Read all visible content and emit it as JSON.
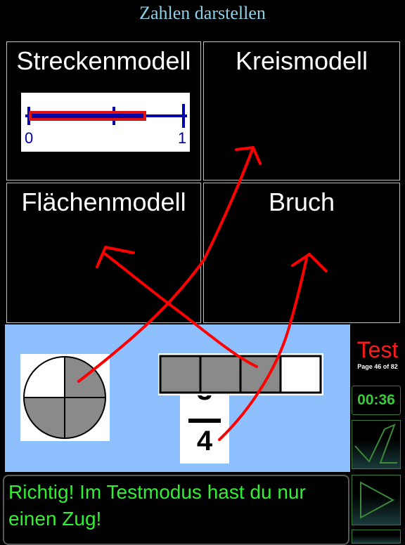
{
  "header": {
    "title": "Zahlen darstellen"
  },
  "targets": {
    "strecke": "Streckenmodell",
    "kreis": "Kreismodell",
    "flaeche": "Flächenmodell",
    "bruch": "Bruch"
  },
  "number_line": {
    "start_label": "0",
    "end_label": "1",
    "marked_fraction": 0.75
  },
  "pieces": {
    "circle": {
      "parts": 4,
      "shaded": 3
    },
    "bar": {
      "parts": 4,
      "shaded": 3
    },
    "fraction": {
      "numerator": "3",
      "denominator": "4"
    }
  },
  "status": {
    "mode_label": "Test",
    "page_info": "Page 46 of 82",
    "timer": "00:36"
  },
  "feedback": {
    "message": "Richtig! Im Testmodus hast du nur einen Zug!"
  },
  "colors": {
    "title": "#8fd0e8",
    "panel": "#8ec0ff",
    "feedback_text": "#33ee33",
    "test_label": "#ff1a1a",
    "stroke": "#ff0000",
    "axis": "#0000aa"
  }
}
